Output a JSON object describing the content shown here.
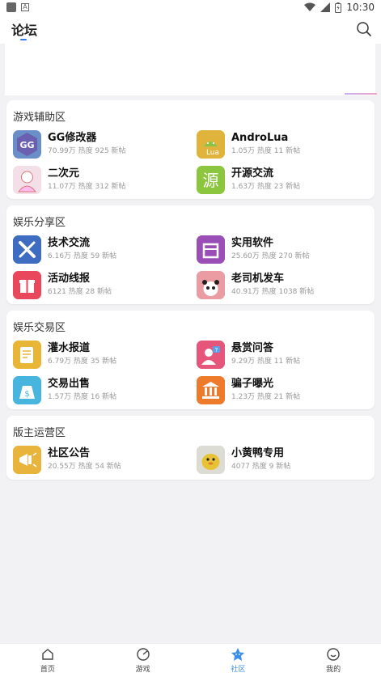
{
  "status_bar": {
    "time": "10:30"
  },
  "header": {
    "title": "论坛"
  },
  "sections": [
    {
      "title": "游戏辅助区",
      "items": [
        {
          "name": "GG修改器",
          "stats": "70.99万 热度  925 新帖",
          "icon": "gg-icon"
        },
        {
          "name": "AndroLua",
          "stats": "1.05万 热度  11 新帖",
          "icon": "lua-icon"
        },
        {
          "name": "二次元",
          "stats": "11.07万 热度  312 新帖",
          "icon": "anime-icon"
        },
        {
          "name": "开源交流",
          "stats": "1.63万 热度  23 新帖",
          "icon": "source-icon"
        }
      ]
    },
    {
      "title": "娱乐分享区",
      "items": [
        {
          "name": "技术交流",
          "stats": "6.16万 热度  59 新帖",
          "icon": "tools-icon"
        },
        {
          "name": "实用软件",
          "stats": "25.60万 热度  270 新帖",
          "icon": "box-icon"
        },
        {
          "name": "活动线报",
          "stats": "6121 热度  28 新帖",
          "icon": "gift-icon"
        },
        {
          "name": "老司机发车",
          "stats": "40.91万 热度  1038 新帖",
          "icon": "panda-icon"
        }
      ]
    },
    {
      "title": "娱乐交易区",
      "items": [
        {
          "name": "灌水报道",
          "stats": "6.79万 热度  35 新帖",
          "icon": "notes-icon"
        },
        {
          "name": "悬赏问答",
          "stats": "9.29万 热度  11 新帖",
          "icon": "question-icon"
        },
        {
          "name": "交易出售",
          "stats": "1.57万 热度  16 新帖",
          "icon": "money-bag-icon"
        },
        {
          "name": "骗子曝光",
          "stats": "1.23万 热度  21 新帖",
          "icon": "bank-icon"
        }
      ]
    },
    {
      "title": "版主运营区",
      "items": [
        {
          "name": "社区公告",
          "stats": "20.55万 热度  54 新帖",
          "icon": "megaphone-icon"
        },
        {
          "name": "小黄鸭专用",
          "stats": "4077 热度  9 新帖",
          "icon": "duck-icon"
        }
      ]
    }
  ],
  "bottom_nav": [
    {
      "label": "首页",
      "icon": "home-icon",
      "active": false
    },
    {
      "label": "游戏",
      "icon": "game-icon",
      "active": false
    },
    {
      "label": "社区",
      "icon": "community-icon",
      "active": true
    },
    {
      "label": "我的",
      "icon": "profile-icon",
      "active": false
    }
  ],
  "colors": {
    "accent": "#3b8fe8"
  }
}
